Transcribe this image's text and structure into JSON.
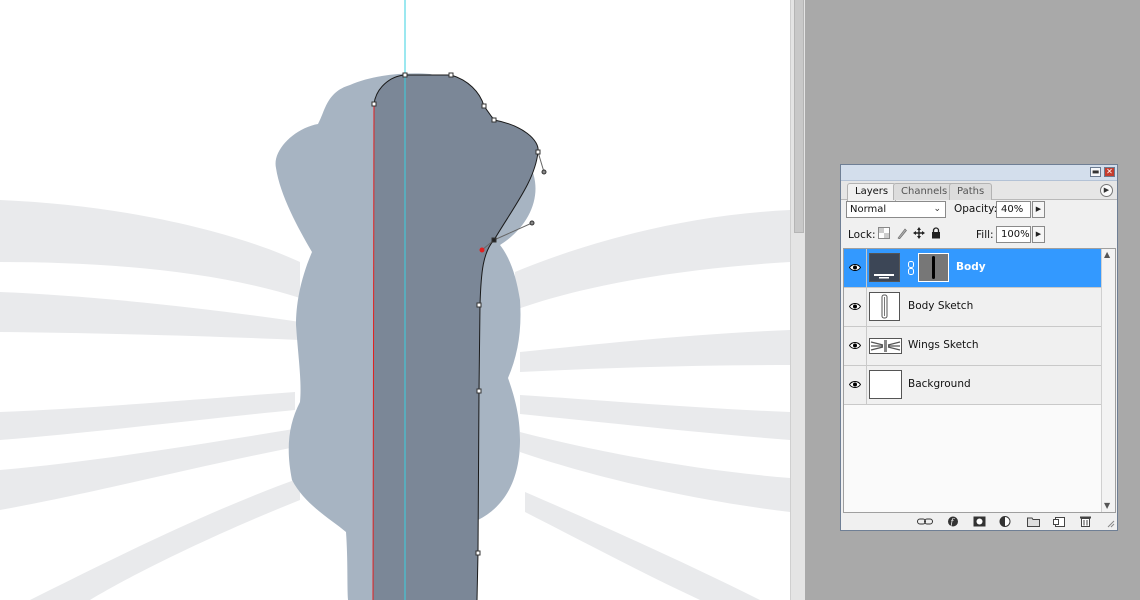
{
  "panel": {
    "tabs": [
      "Layers",
      "Channels",
      "Paths"
    ],
    "active_tab": "Layers",
    "blend_mode": "Normal",
    "opacity_label": "Opacity:",
    "opacity_value": "40%",
    "lock_label": "Lock:",
    "fill_label": "Fill:",
    "fill_value": "100%",
    "layers": [
      {
        "name": "Body",
        "visible": true,
        "selected": true,
        "has_mask": true
      },
      {
        "name": "Body Sketch",
        "visible": true,
        "selected": false
      },
      {
        "name": "Wings Sketch",
        "visible": true,
        "selected": false
      },
      {
        "name": "Background",
        "visible": true,
        "selected": false
      }
    ],
    "footer_icons": [
      "link-layers-icon",
      "layer-style-icon",
      "add-mask-icon",
      "adjustment-layer-icon",
      "new-group-icon",
      "new-layer-icon",
      "delete-layer-icon"
    ]
  },
  "colors": {
    "selection_blue": "#3399ff",
    "guide_cyan": "#39d0e0",
    "path_red": "#e02020",
    "body_fill": "#7b8797",
    "sketch_fill": "#a7b4c2",
    "wing_fill": "#e9eaec",
    "pasteboard": "#a9a9a9"
  }
}
